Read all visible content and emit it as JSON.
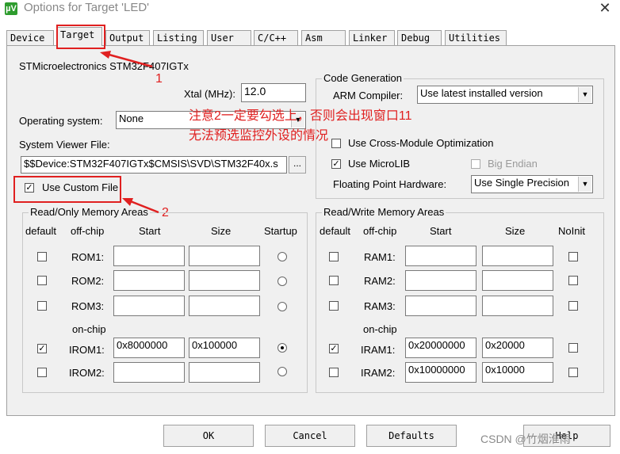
{
  "window": {
    "title": "Options for Target 'LED'",
    "icon_text": "µV",
    "close_glyph": "✕"
  },
  "tabs": [
    "Device",
    "Target",
    "Output",
    "Listing",
    "User",
    "C/C++",
    "Asm",
    "Linker",
    "Debug",
    "Utilities"
  ],
  "active_tab": "Target",
  "device_name": "STMicroelectronics STM32F407IGTx",
  "xtal": {
    "label": "Xtal (MHz):",
    "value": "12.0"
  },
  "os": {
    "label": "Operating system:",
    "value": "None"
  },
  "svd": {
    "label": "System Viewer File:",
    "value": "$$Device:STM32F407IGTx$CMSIS\\SVD\\STM32F40x.s",
    "browse": "..."
  },
  "use_custom_file": {
    "label": "Use Custom File",
    "checked": true
  },
  "code_generation": {
    "title": "Code Generation",
    "compiler_label": "ARM Compiler:",
    "compiler_value": "Use latest installed version",
    "cross_module": {
      "label": "Use Cross-Module Optimization",
      "checked": false
    },
    "microlib": {
      "label": "Use MicroLIB",
      "checked": true
    },
    "big_endian": {
      "label": "Big Endian",
      "checked": false
    },
    "fp_label": "Floating Point Hardware:",
    "fp_value": "Use Single Precision"
  },
  "ro_memory": {
    "title": "Read/Only Memory Areas",
    "headers": {
      "default": "default",
      "offchip": "off-chip",
      "start": "Start",
      "size": "Size",
      "startup": "Startup"
    },
    "onchip_label": "on-chip",
    "rows": [
      {
        "name": "ROM1:",
        "start": "",
        "size": "",
        "default": false,
        "startup": false
      },
      {
        "name": "ROM2:",
        "start": "",
        "size": "",
        "default": false,
        "startup": false
      },
      {
        "name": "ROM3:",
        "start": "",
        "size": "",
        "default": false,
        "startup": false
      },
      {
        "name": "IROM1:",
        "start": "0x8000000",
        "size": "0x100000",
        "default": true,
        "startup": true
      },
      {
        "name": "IROM2:",
        "start": "",
        "size": "",
        "default": false,
        "startup": false
      }
    ]
  },
  "rw_memory": {
    "title": "Read/Write Memory Areas",
    "headers": {
      "default": "default",
      "offchip": "off-chip",
      "start": "Start",
      "size": "Size",
      "noinit": "NoInit"
    },
    "onchip_label": "on-chip",
    "rows": [
      {
        "name": "RAM1:",
        "start": "",
        "size": "",
        "default": false,
        "noinit": false
      },
      {
        "name": "RAM2:",
        "start": "",
        "size": "",
        "default": false,
        "noinit": false
      },
      {
        "name": "RAM3:",
        "start": "",
        "size": "",
        "default": false,
        "noinit": false
      },
      {
        "name": "IRAM1:",
        "start": "0x20000000",
        "size": "0x20000",
        "default": true,
        "noinit": false
      },
      {
        "name": "IRAM2:",
        "start": "0x10000000",
        "size": "0x10000",
        "default": false,
        "noinit": false
      }
    ]
  },
  "buttons": {
    "ok": "OK",
    "cancel": "Cancel",
    "defaults": "Defaults",
    "help": "Help"
  },
  "annotations": {
    "marker_1": "1",
    "marker_2": "2",
    "note_line1": "注意2一定要勾选上，否则会出现窗口11",
    "note_line2": "无法预选监控外设的情况"
  },
  "watermark": "CSDN @竹烟淮雨",
  "colors": {
    "annotation_red": "#e02020",
    "panel_bg": "#f0f0f0"
  }
}
